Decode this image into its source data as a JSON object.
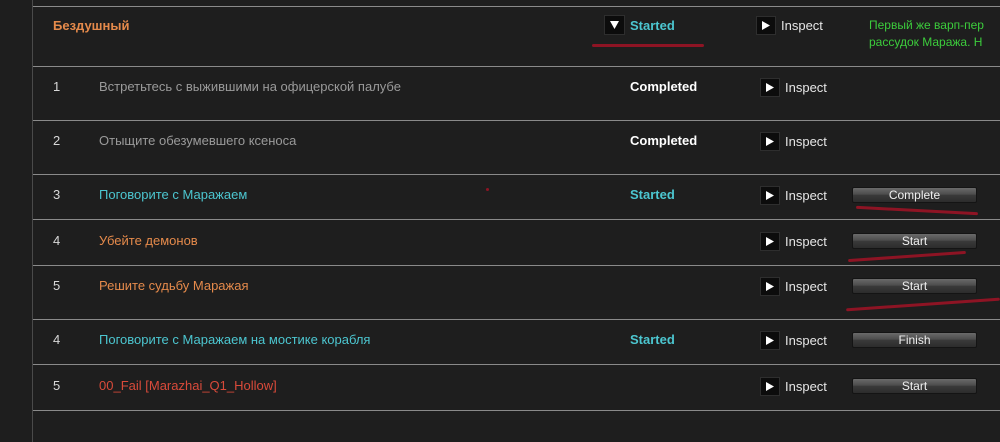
{
  "quest": {
    "name": "Бездушный",
    "status": "Started",
    "inspect_label": "Inspect",
    "description_line1": "Первый же варп-пер",
    "description_line2": "рассудок Маража. Н"
  },
  "steps": [
    {
      "index": "1",
      "title": "Встретьтесь с выжившими на офицерской палубе",
      "status": "Completed",
      "inspect": "Inspect",
      "action": ""
    },
    {
      "index": "2",
      "title": "Отыщите обезумевшего ксеноса",
      "status": "Completed",
      "inspect": "Inspect",
      "action": ""
    },
    {
      "index": "3",
      "title": "Поговорите с Маражаем",
      "status": "Started",
      "inspect": "Inspect",
      "action": "Complete"
    },
    {
      "index": "4",
      "title": "Убейте демонов",
      "status": "",
      "inspect": "Inspect",
      "action": "Start"
    },
    {
      "index": "5",
      "title": "Решите судьбу Маражая",
      "status": "",
      "inspect": "Inspect",
      "action": "Start"
    },
    {
      "index": "4",
      "title": "Поговорите с Маражаем на мостике корабля",
      "status": "Started",
      "inspect": "Inspect",
      "action": "Finish"
    },
    {
      "index": "5",
      "title": "00_Fail [Marazhai_Q1_Hollow]",
      "status": "",
      "inspect": "Inspect",
      "action": "Start"
    }
  ],
  "colors": {
    "started": "#4cc6d0",
    "completed": "#ffffff",
    "pending_title": "#e58a4b",
    "done_title": "#9a9a9a",
    "fail_title": "#d94a3a",
    "quest_name": "#e58a4b",
    "description": "#3ccc3c",
    "annotation": "#8e1424"
  }
}
